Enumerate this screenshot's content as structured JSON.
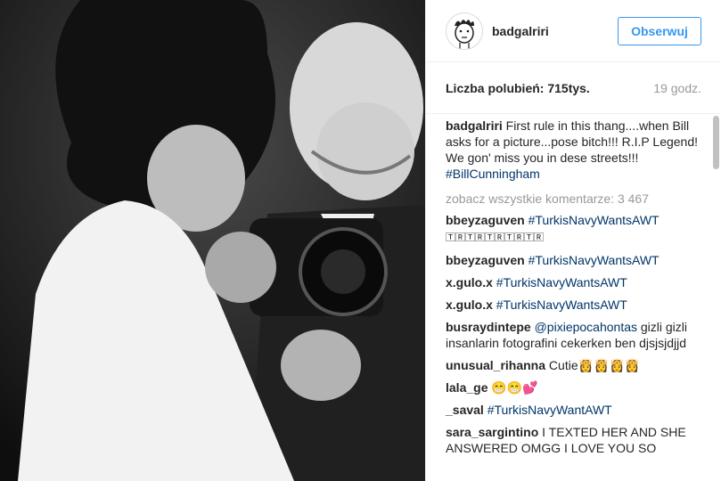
{
  "profile": {
    "username": "badgalriri",
    "follow_label": "Obserwuj"
  },
  "stats": {
    "likes": "Liczba polubień: 715tys.",
    "time": "19 godz."
  },
  "caption": {
    "user": "badgalriri",
    "text": " First rule in this thang....when Bill asks for a picture...pose bitch!!! R.I.P Legend!  We gon' miss you in dese streets!!! ",
    "hashtag": "#BillCunningham"
  },
  "view_all": "zobacz wszystkie komentarze: 3 467",
  "comments": [
    {
      "user": "bbeyzaguven",
      "pre": " ",
      "tag": "#TurkisNavyWantsAWT",
      "post": "",
      "extra": "🅃🅁🅃🅁🅃🅁🅃🅁🅃🅁"
    },
    {
      "user": "bbeyzaguven",
      "pre": " ",
      "tag": "#TurkisNavyWantsAWT",
      "post": ""
    },
    {
      "user": "x.gulo.x",
      "pre": " ",
      "tag": "#TurkisNavyWantsAWT",
      "post": ""
    },
    {
      "user": "x.gulo.x",
      "pre": " ",
      "tag": "#TurkisNavyWantsAWT",
      "post": ""
    },
    {
      "user": "busraydintepe",
      "pre": " ",
      "tag": "@pixiepocahontas",
      "post": " gizli gizli insanlarin fotografini cekerken ben djsjsjdjjd"
    },
    {
      "user": "unusual_rihanna",
      "pre": " Cutie👸👸👸👸",
      "tag": "",
      "post": ""
    },
    {
      "user": "lala_ge",
      "pre": " 😁😁💕",
      "tag": "",
      "post": ""
    },
    {
      "user": "_saval",
      "pre": " ",
      "tag": "#TurkisNavyWantAWT",
      "post": ""
    },
    {
      "user": "sara_sargintino",
      "pre": " I TEXTED HER AND SHE ANSWERED OMGG I LOVE YOU SO",
      "tag": "",
      "post": ""
    }
  ],
  "icons": {
    "avatar": "cartoon-face-avatar"
  },
  "colors": {
    "link": "#003569",
    "follow": "#3897f0",
    "muted": "#999999"
  }
}
